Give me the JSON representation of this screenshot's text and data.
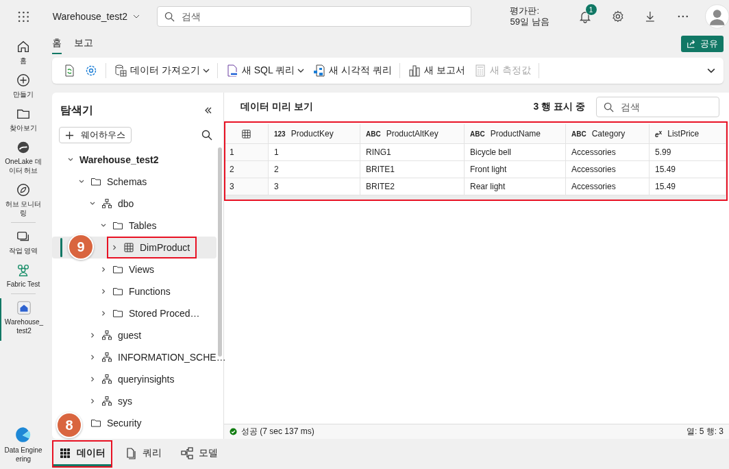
{
  "topbar": {
    "workspace": "Warehouse_test2",
    "search": {
      "placeholder": "검색"
    },
    "trial": [
      "평가판:",
      "59일 남음"
    ],
    "notifications": "1"
  },
  "rail": [
    {
      "label": "홈",
      "kind": "home",
      "selected": false
    },
    {
      "label": "만들기",
      "kind": "create",
      "selected": false
    },
    {
      "label": "찾아보기",
      "kind": "browse",
      "selected": false
    },
    {
      "label": "OneLake 데이터 허브",
      "kind": "onelake",
      "selected": false
    },
    {
      "label": "허브 모니터링",
      "kind": "monitor",
      "selected": false
    },
    {
      "label": "작업 영역",
      "kind": "workspaces",
      "selected": false
    },
    {
      "label": "Fabric Test",
      "kind": "team",
      "selected": false
    },
    {
      "label": "Warehouse_test2",
      "kind": "warehouse",
      "selected": true
    }
  ],
  "rail_bottom": {
    "label": "Data Engineering"
  },
  "tabs": [
    {
      "label": "홈",
      "selected": true
    },
    {
      "label": "보고",
      "selected": false
    }
  ],
  "share_button": "공유",
  "toolbar": [
    {
      "kind": "refresh",
      "disabled": false
    },
    {
      "kind": "settings",
      "disabled": false
    },
    {
      "kind": "get-data",
      "label": "데이터 가져오기",
      "dropdown": true,
      "disabled": false
    },
    {
      "kind": "sql",
      "label": "새 SQL 쿼리",
      "dropdown": true,
      "disabled": false
    },
    {
      "kind": "visual",
      "label": "새 시각적 쿼리",
      "dropdown": false,
      "disabled": false
    },
    {
      "kind": "report",
      "label": "새 보고서",
      "dropdown": false,
      "disabled": false
    },
    {
      "kind": "measure",
      "label": "새 측정값",
      "dropdown": false,
      "disabled": true
    }
  ],
  "explorer": {
    "title": "탐색기",
    "add_button": "웨어하우스",
    "tree": [
      {
        "label": "Warehouse_test2",
        "kind": "warehouse",
        "expanded": true,
        "selected": false,
        "children": [
          {
            "label": "Schemas",
            "kind": "folder",
            "expanded": true,
            "selected": false,
            "children": [
              {
                "label": "dbo",
                "kind": "schema",
                "expanded": true,
                "selected": false,
                "children": [
                  {
                    "label": "Tables",
                    "kind": "folder",
                    "expanded": true,
                    "selected": false,
                    "children": [
                      {
                        "label": "DimProduct",
                        "kind": "table",
                        "expanded": false,
                        "selected": true,
                        "highlighted": true
                      }
                    ]
                  },
                  {
                    "label": "Views",
                    "kind": "folder",
                    "expanded": false,
                    "selected": false
                  },
                  {
                    "label": "Functions",
                    "kind": "folder",
                    "expanded": false,
                    "selected": false
                  },
                  {
                    "label": "Stored Proced…",
                    "kind": "folder",
                    "expanded": false,
                    "selected": false
                  }
                ]
              },
              {
                "label": "guest",
                "kind": "schema",
                "expanded": false,
                "selected": false
              },
              {
                "label": "INFORMATION_SCHE…",
                "kind": "schema",
                "expanded": false,
                "selected": false
              },
              {
                "label": "queryinsights",
                "kind": "schema",
                "expanded": false,
                "selected": false
              },
              {
                "label": "sys",
                "kind": "schema",
                "expanded": false,
                "selected": false
              }
            ]
          },
          {
            "label": "Security",
            "kind": "folder",
            "selected": false
          }
        ]
      }
    ]
  },
  "preview": {
    "title": "데이터 미리 보기",
    "row_count": "3 행 표시 중",
    "search": {
      "placeholder": "검색"
    },
    "highlighted": true,
    "columns": [
      {
        "type_label": "123",
        "name": "ProductKey"
      },
      {
        "type_label": "ABC",
        "name": "ProductAltKey"
      },
      {
        "type_label": "ABC",
        "name": "ProductName"
      },
      {
        "type_label": "ABC",
        "name": "Category"
      },
      {
        "type_label": "*e*$^{x}$",
        "name": "ListPrice"
      }
    ],
    "rows": [
      {
        "number": "1",
        "cells": [
          "1",
          "RING1",
          "Bicycle bell",
          "Accessories",
          "5.99"
        ]
      },
      {
        "number": "2",
        "cells": [
          "2",
          "BRITE1",
          "Front light",
          "Accessories",
          "15.49"
        ]
      },
      {
        "number": "3",
        "cells": [
          "3",
          "BRITE2",
          "Rear light",
          "Accessories",
          "15.49"
        ]
      }
    ],
    "status": {
      "success": true,
      "text": "성공 (7 sec 137 ms)",
      "summary": "열: 5 행: 3"
    }
  },
  "bottom_tabs": [
    {
      "label": "데이터",
      "kind": "data",
      "selected": true,
      "highlighted": true
    },
    {
      "label": "쿼리",
      "kind": "query",
      "selected": false,
      "highlighted": false
    },
    {
      "label": "모델",
      "kind": "model",
      "selected": false,
      "highlighted": false
    }
  ],
  "callouts": [
    {
      "label": "9"
    },
    {
      "label": "8"
    }
  ]
}
